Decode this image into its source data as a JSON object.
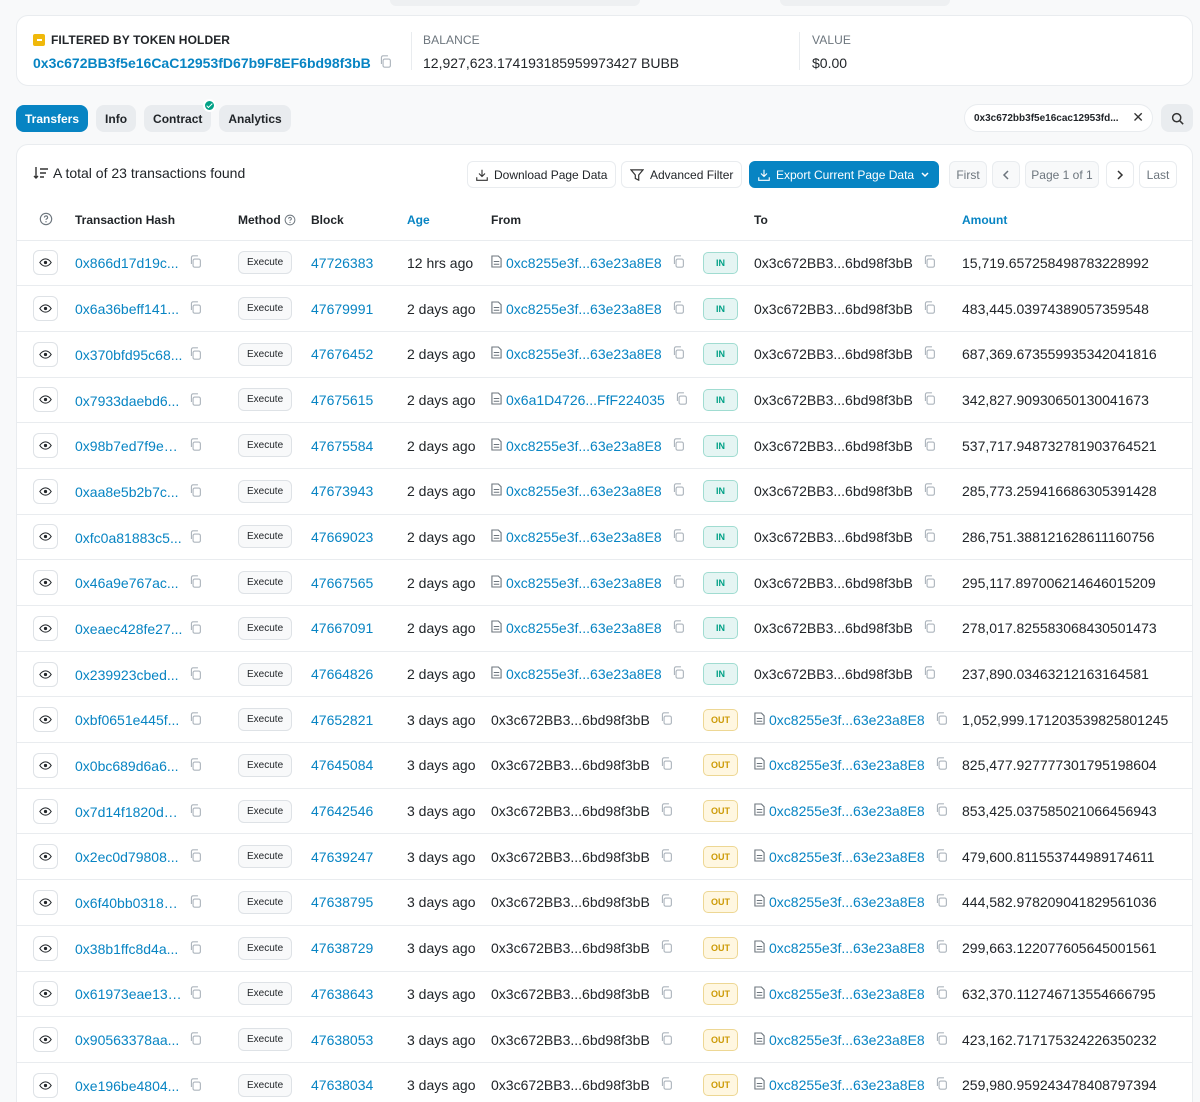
{
  "summary": {
    "holder_label": "FILTERED BY TOKEN HOLDER",
    "holder_address": "0x3c672BB3f5e16CaC12953fD67b9F8EF6bd98f3bB",
    "balance_label": "BALANCE",
    "balance_value": "12,927,623.174193185959973427 BUBB",
    "value_label": "VALUE",
    "value_value": "$0.00"
  },
  "tabs": [
    "Transfers",
    "Info",
    "Contract",
    "Analytics"
  ],
  "filter_chip": "0x3c672bb3f5e16cac12953fd...",
  "toolbar": {
    "total_text": "A total of 23 transactions found",
    "download": "Download Page Data",
    "advanced_filter": "Advanced Filter",
    "export": "Export Current Page Data",
    "first": "First",
    "page": "Page 1 of 1",
    "last": "Last"
  },
  "columns": [
    "Transaction Hash",
    "Method",
    "Block",
    "Age",
    "From",
    "To",
    "Amount"
  ],
  "colors": {
    "accent": "#0784c3",
    "in": "#00a186",
    "out": "#cc9a06"
  },
  "rows": [
    {
      "hash": "0x866d17d19c...",
      "method": "Execute",
      "block": "47726383",
      "age": "12 hrs ago",
      "from": "0xc8255e3f...63e23a8E8",
      "dir": "IN",
      "to": "0x3c672BB3...6bd98f3bB",
      "amount": "15,719.657258498783228992"
    },
    {
      "hash": "0x6a36beff141...",
      "method": "Execute",
      "block": "47679991",
      "age": "2 days ago",
      "from": "0xc8255e3f...63e23a8E8",
      "dir": "IN",
      "to": "0x3c672BB3...6bd98f3bB",
      "amount": "483,445.03974389057359548"
    },
    {
      "hash": "0x370bfd95c68...",
      "method": "Execute",
      "block": "47676452",
      "age": "2 days ago",
      "from": "0xc8255e3f...63e23a8E8",
      "dir": "IN",
      "to": "0x3c672BB3...6bd98f3bB",
      "amount": "687,369.673559935342041816"
    },
    {
      "hash": "0x7933daebd6...",
      "method": "Execute",
      "block": "47675615",
      "age": "2 days ago",
      "from": "0x6a1D4726...FfF224035",
      "dir": "IN",
      "to": "0x3c672BB3...6bd98f3bB",
      "amount": "342,827.90930650130041673"
    },
    {
      "hash": "0x98b7ed7f9ed...",
      "method": "Execute",
      "block": "47675584",
      "age": "2 days ago",
      "from": "0xc8255e3f...63e23a8E8",
      "dir": "IN",
      "to": "0x3c672BB3...6bd98f3bB",
      "amount": "537,717.948732781903764521"
    },
    {
      "hash": "0xaa8e5b2b7c...",
      "method": "Execute",
      "block": "47673943",
      "age": "2 days ago",
      "from": "0xc8255e3f...63e23a8E8",
      "dir": "IN",
      "to": "0x3c672BB3...6bd98f3bB",
      "amount": "285,773.259416686305391428"
    },
    {
      "hash": "0xfc0a81883c5...",
      "method": "Execute",
      "block": "47669023",
      "age": "2 days ago",
      "from": "0xc8255e3f...63e23a8E8",
      "dir": "IN",
      "to": "0x3c672BB3...6bd98f3bB",
      "amount": "286,751.388121628611160756"
    },
    {
      "hash": "0x46a9e767ac...",
      "method": "Execute",
      "block": "47667565",
      "age": "2 days ago",
      "from": "0xc8255e3f...63e23a8E8",
      "dir": "IN",
      "to": "0x3c672BB3...6bd98f3bB",
      "amount": "295,117.897006214646015209"
    },
    {
      "hash": "0xeaec428fe27...",
      "method": "Execute",
      "block": "47667091",
      "age": "2 days ago",
      "from": "0xc8255e3f...63e23a8E8",
      "dir": "IN",
      "to": "0x3c672BB3...6bd98f3bB",
      "amount": "278,017.825583068430501473"
    },
    {
      "hash": "0x239923cbed...",
      "method": "Execute",
      "block": "47664826",
      "age": "2 days ago",
      "from": "0xc8255e3f...63e23a8E8",
      "dir": "IN",
      "to": "0x3c672BB3...6bd98f3bB",
      "amount": "237,890.03463212163164581"
    },
    {
      "hash": "0xbf0651e445f...",
      "method": "Execute",
      "block": "47652821",
      "age": "3 days ago",
      "from": "0x3c672BB3...6bd98f3bB",
      "dir": "OUT",
      "to": "0xc8255e3f...63e23a8E8",
      "amount": "1,052,999.171203539825801245"
    },
    {
      "hash": "0x0bc689d6a6...",
      "method": "Execute",
      "block": "47645084",
      "age": "3 days ago",
      "from": "0x3c672BB3...6bd98f3bB",
      "dir": "OUT",
      "to": "0xc8255e3f...63e23a8E8",
      "amount": "825,477.927777301795198604"
    },
    {
      "hash": "0x7d14f1820d6...",
      "method": "Execute",
      "block": "47642546",
      "age": "3 days ago",
      "from": "0x3c672BB3...6bd98f3bB",
      "dir": "OUT",
      "to": "0xc8255e3f...63e23a8E8",
      "amount": "853,425.037585021066456943"
    },
    {
      "hash": "0x2ec0d79808...",
      "method": "Execute",
      "block": "47639247",
      "age": "3 days ago",
      "from": "0x3c672BB3...6bd98f3bB",
      "dir": "OUT",
      "to": "0xc8255e3f...63e23a8E8",
      "amount": "479,600.811553744989174611"
    },
    {
      "hash": "0x6f40bb03180...",
      "method": "Execute",
      "block": "47638795",
      "age": "3 days ago",
      "from": "0x3c672BB3...6bd98f3bB",
      "dir": "OUT",
      "to": "0xc8255e3f...63e23a8E8",
      "amount": "444,582.978209041829561036"
    },
    {
      "hash": "0x38b1ffc8d4a...",
      "method": "Execute",
      "block": "47638729",
      "age": "3 days ago",
      "from": "0x3c672BB3...6bd98f3bB",
      "dir": "OUT",
      "to": "0xc8255e3f...63e23a8E8",
      "amount": "299,663.122077605645001561"
    },
    {
      "hash": "0x61973eae13f...",
      "method": "Execute",
      "block": "47638643",
      "age": "3 days ago",
      "from": "0x3c672BB3...6bd98f3bB",
      "dir": "OUT",
      "to": "0xc8255e3f...63e23a8E8",
      "amount": "632,370.112746713554666795"
    },
    {
      "hash": "0x90563378aa...",
      "method": "Execute",
      "block": "47638053",
      "age": "3 days ago",
      "from": "0x3c672BB3...6bd98f3bB",
      "dir": "OUT",
      "to": "0xc8255e3f...63e23a8E8",
      "amount": "423,162.717175324226350232"
    },
    {
      "hash": "0xe196be4804...",
      "method": "Execute",
      "block": "47638034",
      "age": "3 days ago",
      "from": "0x3c672BB3...6bd98f3bB",
      "dir": "OUT",
      "to": "0xc8255e3f...63e23a8E8",
      "amount": "259,980.959243478408797394"
    }
  ]
}
